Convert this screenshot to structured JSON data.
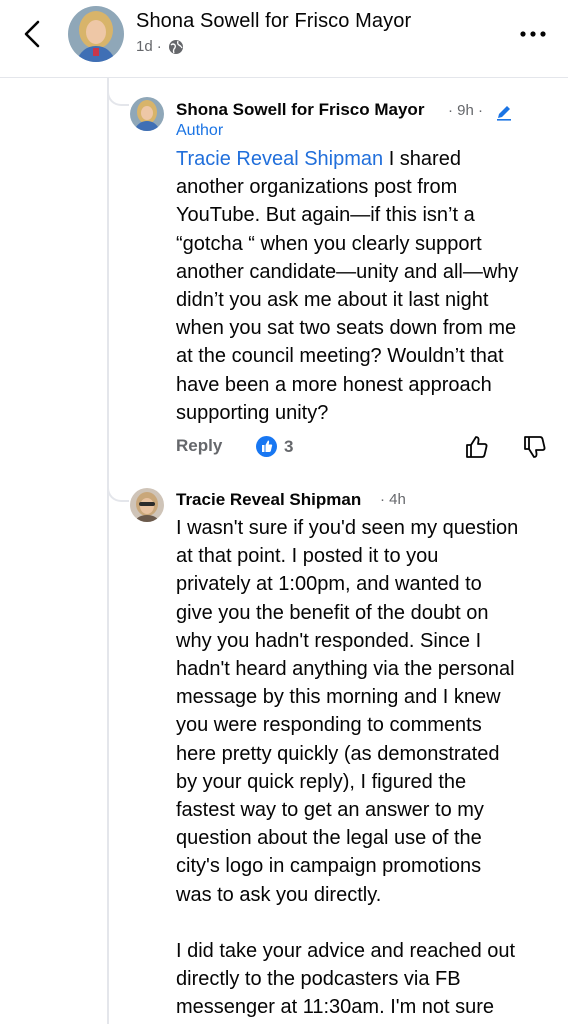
{
  "header": {
    "title": "Shona Sowell for Frisco Mayor",
    "time": "1d",
    "dot": "·"
  },
  "comments": [
    {
      "author": "Shona Sowell for Frisco Mayor",
      "time": "· 9h ·",
      "badge": "Author",
      "mention": "Tracie Reveal Shipman",
      "lines": [
        " I shared",
        "another organizations post from",
        "YouTube. But again—if this isn’t a",
        "“gotcha “ when you clearly support",
        "another candidate—unity and all—why",
        "didn’t you ask me about it last night",
        "when you sat two seats down from me",
        "at the council meeting? Wouldn’t that",
        "have been  a more honest approach",
        "supporting unity?"
      ],
      "reply_label": "Reply",
      "like_count": "3"
    },
    {
      "author": "Tracie Reveal Shipman",
      "time": "· 4h",
      "lines": [
        "I wasn't sure if you'd seen my question",
        "at that point. I posted it to you",
        "privately at 1:00pm, and wanted to",
        "give you the benefit of the doubt on",
        "why you hadn't responded. Since I",
        "hadn't heard anything via the personal",
        "message by this morning and I knew",
        "you were responding to comments",
        "here pretty quickly (as demonstrated",
        "by your quick reply), I figured the",
        "fastest way to get an answer to my",
        "question about the legal use of the",
        "city's logo in campaign promotions",
        "was to ask you directly.",
        "",
        "I did take your advice and reached out",
        "directly to the podcasters via FB",
        "messenger at 11:30am. I'm not sure"
      ]
    }
  ],
  "colors": {
    "accent": "#1877f2",
    "mention": "#216fdb",
    "secondary_text": "#65676b",
    "divider": "#e4e6eb"
  },
  "icons": [
    "back-arrow-icon",
    "globe-icon",
    "more-options-icon",
    "edit-pencil-icon",
    "like-thumb-icon",
    "thumbs-up-icon",
    "thumbs-down-icon"
  ]
}
